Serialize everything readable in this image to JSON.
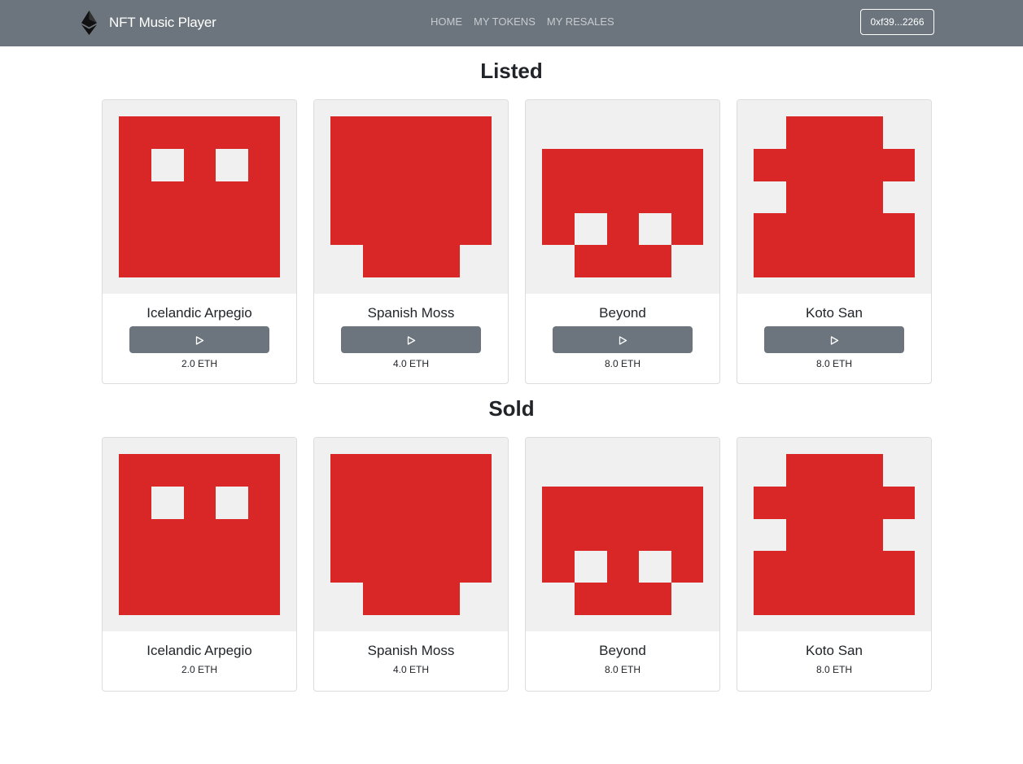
{
  "navbar": {
    "brand_icon": "ethereum-icon",
    "brand_name": "NFT Music Player",
    "links": [
      "HOME",
      "MY TOKENS",
      "MY RESALES"
    ],
    "account": "0xf39...2266"
  },
  "colors": {
    "navbar": "#6c757d",
    "art": "#d92626",
    "art_bg": "#f0f0f0"
  },
  "listed": {
    "title": "Listed",
    "items": [
      {
        "title": "Icelandic Arpegio",
        "price": "2.0 ETH",
        "play_icon": "play-icon"
      },
      {
        "title": "Spanish Moss",
        "price": "4.0 ETH",
        "play_icon": "play-icon"
      },
      {
        "title": "Beyond",
        "price": "8.0 ETH",
        "play_icon": "play-icon"
      },
      {
        "title": "Koto San",
        "price": "8.0 ETH",
        "play_icon": "play-icon"
      }
    ]
  },
  "sold": {
    "title": "Sold",
    "items": [
      {
        "title": "Icelandic Arpegio",
        "price": "2.0 ETH"
      },
      {
        "title": "Spanish Moss",
        "price": "4.0 ETH"
      },
      {
        "title": "Beyond",
        "price": "8.0 ETH"
      },
      {
        "title": "Koto San",
        "price": "8.0 ETH"
      }
    ]
  }
}
